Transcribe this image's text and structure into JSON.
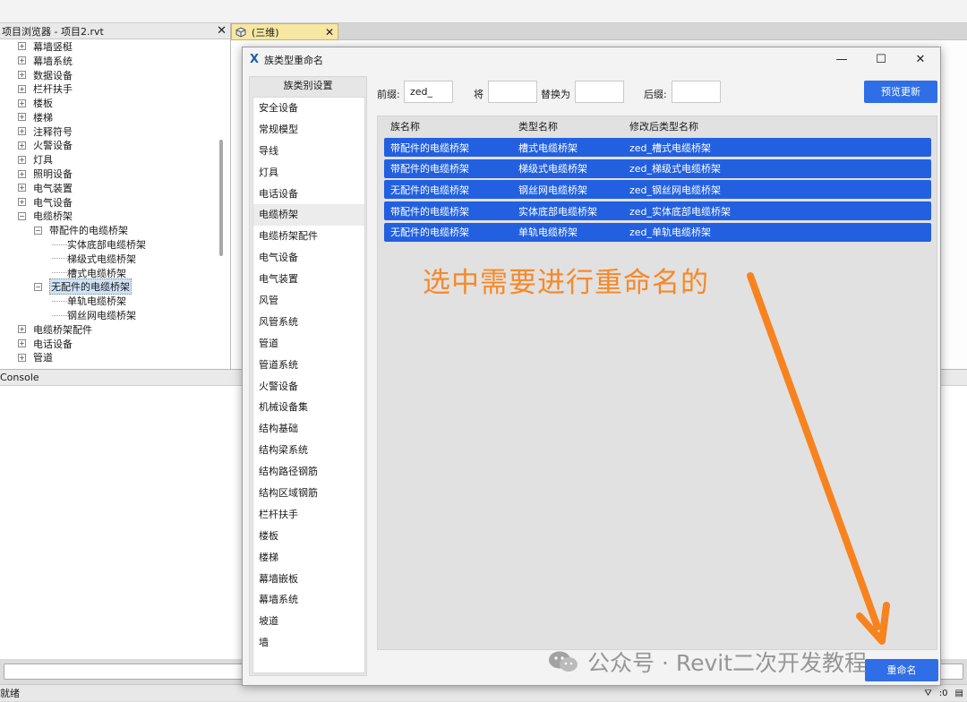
{
  "project_browser": {
    "title": "项目浏览器 - 项目2.rvt",
    "items": [
      {
        "label": "幕墙竖梃",
        "level": 0,
        "toggle": "⊞"
      },
      {
        "label": "幕墙系统",
        "level": 0,
        "toggle": "⊞"
      },
      {
        "label": "数据设备",
        "level": 0,
        "toggle": "⊞"
      },
      {
        "label": "栏杆扶手",
        "level": 0,
        "toggle": "⊞"
      },
      {
        "label": "楼板",
        "level": 0,
        "toggle": "⊞"
      },
      {
        "label": "楼梯",
        "level": 0,
        "toggle": "⊞"
      },
      {
        "label": "注释符号",
        "level": 0,
        "toggle": "⊞"
      },
      {
        "label": "火警设备",
        "level": 0,
        "toggle": "⊞"
      },
      {
        "label": "灯具",
        "level": 0,
        "toggle": "⊞"
      },
      {
        "label": "照明设备",
        "level": 0,
        "toggle": "⊞"
      },
      {
        "label": "电气装置",
        "level": 0,
        "toggle": "⊞"
      },
      {
        "label": "电气设备",
        "level": 0,
        "toggle": "⊞"
      },
      {
        "label": "电缆桥架",
        "level": 0,
        "toggle": "⊟"
      },
      {
        "label": "带配件的电缆桥架",
        "level": 1,
        "toggle": "⊟"
      },
      {
        "label": "实体底部电缆桥架",
        "level": 2,
        "toggle": ""
      },
      {
        "label": "梯级式电缆桥架",
        "level": 2,
        "toggle": ""
      },
      {
        "label": "槽式电缆桥架",
        "level": 2,
        "toggle": ""
      },
      {
        "label": "无配件的电缆桥架",
        "level": 1,
        "toggle": "⊟",
        "selected": true
      },
      {
        "label": "单轨电缆桥架",
        "level": 2,
        "toggle": ""
      },
      {
        "label": "钢丝网电缆桥架",
        "level": 2,
        "toggle": ""
      },
      {
        "label": "电缆桥架配件",
        "level": 0,
        "toggle": "⊞"
      },
      {
        "label": "电话设备",
        "level": 0,
        "toggle": "⊞"
      },
      {
        "label": "管道",
        "level": 0,
        "toggle": "⊞"
      }
    ]
  },
  "view_tab": {
    "label": "(三维)",
    "close": "✕"
  },
  "console": {
    "title": "Console"
  },
  "status": {
    "text": "就绪",
    "right_value": ":0"
  },
  "dialog": {
    "title": "族类型重命名",
    "category_header": "族类别设置",
    "categories": [
      "安全设备",
      "常规模型",
      "导线",
      "灯具",
      "电话设备",
      "电缆桥架",
      "电缆桥架配件",
      "电气设备",
      "电气装置",
      "风管",
      "风管系统",
      "管道",
      "管道系统",
      "火警设备",
      "机械设备集",
      "结构基础",
      "结构梁系统",
      "结构路径钢筋",
      "结构区域钢筋",
      "栏杆扶手",
      "楼板",
      "楼梯",
      "幕墙嵌板",
      "幕墙系统",
      "坡道",
      "墙"
    ],
    "active_category_index": 5,
    "prefix_label": "前缀:",
    "prefix_value": "zed_",
    "replace_from_label": "将",
    "replace_from_value": "",
    "replace_to_label": "替换为",
    "replace_to_value": "",
    "suffix_label": "后缀:",
    "suffix_value": "",
    "preview_button": "预览更新",
    "columns": [
      "族名称",
      "类型名称",
      "修改后类型名称"
    ],
    "rows": [
      {
        "family": "带配件的电缆桥架",
        "type": "槽式电缆桥架",
        "renamed": "zed_槽式电缆桥架"
      },
      {
        "family": "带配件的电缆桥架",
        "type": "梯级式电缆桥架",
        "renamed": "zed_梯级式电缆桥架"
      },
      {
        "family": "无配件的电缆桥架",
        "type": "钢丝网电缆桥架",
        "renamed": "zed_钢丝网电缆桥架"
      },
      {
        "family": "带配件的电缆桥架",
        "type": "实体底部电缆桥架",
        "renamed": "zed_实体底部电缆桥架"
      },
      {
        "family": "无配件的电缆桥架",
        "type": "单轨电缆桥架",
        "renamed": "zed_单轨电缆桥架"
      }
    ],
    "rename_button": "重命名",
    "minimize": "—",
    "maximize": "☐",
    "close": "✕"
  },
  "annotation": {
    "text": "选中需要进行重命名的",
    "color": "#f28a2e"
  },
  "watermark": {
    "text": "公众号 · Revit二次开发教程"
  }
}
